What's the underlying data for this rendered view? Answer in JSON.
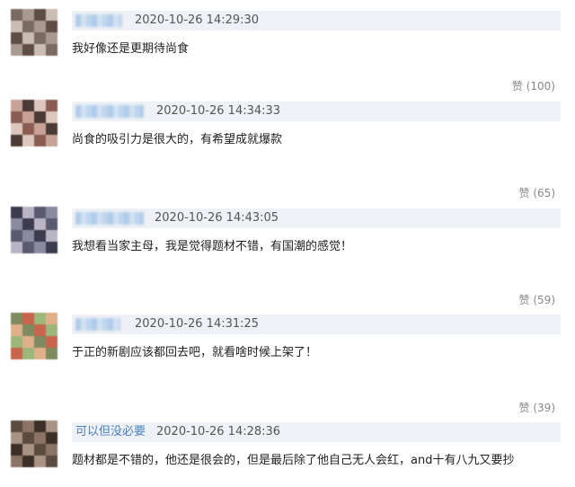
{
  "comments": [
    {
      "time": "2020-10-26 14:29:30",
      "content": "我好像还是更期待尚食",
      "like": "赞 (100)",
      "avatar_colors": [
        "#7a6a62",
        "#a89a90",
        "#5e4d46",
        "#c9bdb4"
      ]
    },
    {
      "time": "2020-10-26 14:34:33",
      "content": "尚食的吸引力是很大的，有希望成就爆款",
      "like": "赞 (65)",
      "avatar_colors": [
        "#8a5d52",
        "#c7a295",
        "#4b3a36",
        "#dcc6bd"
      ]
    },
    {
      "time": "2020-10-26 14:43:05",
      "content": "我想看当家主母，我是觉得题材不错，有国潮的感觉！",
      "like": "赞 (59)",
      "avatar_colors": [
        "#5a5a70",
        "#8a8aa0",
        "#3d3b4e",
        "#b9b5c4"
      ]
    },
    {
      "time": "2020-10-26 14:31:25",
      "content": "于正的新剧应该都回去吧，就看啥时候上架了！",
      "like": "赞 (39)",
      "avatar_colors": [
        "#c9644e",
        "#9db77a",
        "#e0b08a",
        "#7d8b5e"
      ]
    },
    {
      "username": "可以但没必要",
      "time": "2020-10-26 14:28:36",
      "content": "题材都是不错的，他还是很会的，但是最后除了他自己无人会红，and十有八九又要抄",
      "avatar_colors": [
        "#5b4a3f",
        "#8b7466",
        "#3b2f28",
        "#a99384"
      ]
    }
  ]
}
